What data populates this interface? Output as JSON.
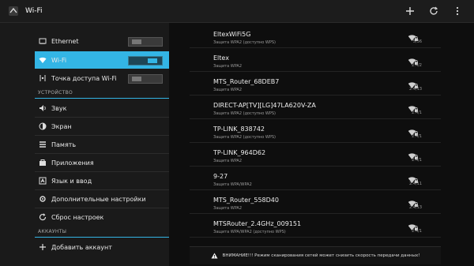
{
  "app": {
    "title": "Wi-Fi"
  },
  "sidebar": {
    "items": [
      {
        "label": "Ethernet",
        "icon": "ethernet-icon",
        "toggle": "off"
      },
      {
        "label": "Wi-Fi",
        "icon": "wifi-icon",
        "toggle": "on",
        "active": true
      },
      {
        "label": "Точка доступа Wi-Fi",
        "icon": "hotspot-icon",
        "toggle": "off"
      }
    ],
    "section_device": "УСТРОЙСТВО",
    "device_items": [
      {
        "label": "Звук",
        "icon": "sound-icon"
      },
      {
        "label": "Экран",
        "icon": "display-icon"
      },
      {
        "label": "Память",
        "icon": "storage-icon"
      },
      {
        "label": "Приложения",
        "icon": "apps-icon"
      },
      {
        "label": "Язык и ввод",
        "icon": "language-icon"
      },
      {
        "label": "Дополнительные настройки",
        "icon": "advanced-settings-icon"
      },
      {
        "label": "Сброс настроек",
        "icon": "reset-icon"
      }
    ],
    "section_accounts": "АККАУНТЫ",
    "account_items": [
      {
        "label": "Добавить аккаунт",
        "icon": "add-icon"
      }
    ]
  },
  "networks": [
    {
      "ssid": "EltexWiFi5G",
      "security": "Защита WPA2 (доступно WPS)",
      "band": "5/36"
    },
    {
      "ssid": "Eltex",
      "security": "Защита WPA2",
      "band": "2.4/2"
    },
    {
      "ssid": "MTS_Router_68DEB7",
      "security": "Защита WPA2",
      "band": "2.4/13"
    },
    {
      "ssid": "DIRECT-AP[TV][LG]47LA620V-ZA",
      "security": "Защита WPA2 (доступно WPS)",
      "band": "2.4/1"
    },
    {
      "ssid": "TP-LINK_838742",
      "security": "Защита WPA2 (доступно WPS)",
      "band": "2.4/1"
    },
    {
      "ssid": "TP-LINK_964D62",
      "security": "Защита WPA2",
      "band": "2.4/1"
    },
    {
      "ssid": "9-27",
      "security": "Защита WPA/WPA2",
      "band": "2.4/11"
    },
    {
      "ssid": "MTS_Router_558D40",
      "security": "Защита WPA2",
      "band": "2.4/13"
    },
    {
      "ssid": "MTSRouter_2.4GHz_009151",
      "security": "Защита WPA/WPA2 (доступно WPS)",
      "band": "2.4/1"
    }
  ],
  "warning": "ВНИМАНИЕ!!! Режим сканирования сетей может снизить скорость передачи данных!",
  "colors": {
    "accent": "#33b5e5",
    "background": "#0d0d0d",
    "sidebar": "#1a1a1a"
  }
}
